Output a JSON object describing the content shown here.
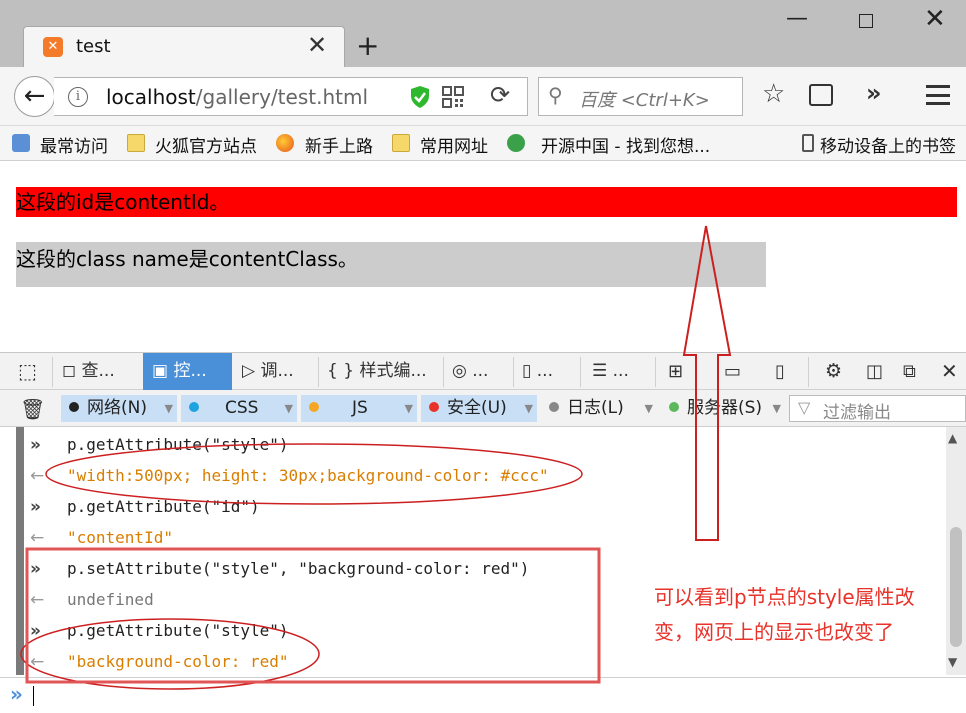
{
  "window": {
    "tab_title": "test",
    "tab_icon_glyph": "✕",
    "new_tab": "+",
    "minimize": "—",
    "close": "✕"
  },
  "nav": {
    "back": "←",
    "url_host": "localhost",
    "url_path": "/gallery/test.html",
    "reload": "⟳",
    "search_placeholder": "百度 <Ctrl+K>",
    "more": "»"
  },
  "bookmarks": [
    {
      "label": "最常访问",
      "icon": "most-visited-icon"
    },
    {
      "label": "火狐官方站点",
      "icon": "folder-icon"
    },
    {
      "label": "新手上路",
      "icon": "firefox-icon"
    },
    {
      "label": "常用网址",
      "icon": "folder-icon"
    },
    {
      "label": "开源中国 - 找到您想...",
      "icon": "oschina-icon"
    },
    {
      "label": "移动设备上的书签",
      "icon": "mobile-icon"
    }
  ],
  "page": {
    "para_id": "这段的id是contentId。",
    "para_class": "这段的class name是contentClass。"
  },
  "devtools": {
    "tabs": [
      {
        "label": "查...",
        "icon": "inspector-icon"
      },
      {
        "label": "控...",
        "icon": "console-icon",
        "active": true
      },
      {
        "label": "调...",
        "icon": "debugger-icon"
      },
      {
        "label": "样式编...",
        "icon": "style-editor-icon"
      },
      {
        "label": "...",
        "icon": "performance-icon"
      },
      {
        "label": "...",
        "icon": "memory-icon"
      },
      {
        "label": "...",
        "icon": "network-icon"
      }
    ],
    "filters": [
      {
        "label": "网络(N)",
        "color": "#222222",
        "on": true
      },
      {
        "label": "CSS",
        "color": "#1fa3e0",
        "on": true
      },
      {
        "label": "JS",
        "color": "#f5a623",
        "on": true
      },
      {
        "label": "安全(U)",
        "color": "#e8322a",
        "on": true
      },
      {
        "label": "日志(L)",
        "color": "#888888",
        "on": false
      },
      {
        "label": "服务器(S)",
        "color": "#5cb85c",
        "on": false
      }
    ],
    "filter_placeholder": "过滤输出"
  },
  "console": {
    "lines": [
      {
        "kind": "in",
        "text": "p.getAttribute(\"style\")"
      },
      {
        "kind": "out",
        "text": "\"width:500px; height: 30px;background-color: #ccc\""
      },
      {
        "kind": "in",
        "text": "p.getAttribute(\"id\")"
      },
      {
        "kind": "out",
        "text": "\"contentId\""
      },
      {
        "kind": "in",
        "text": "p.setAttribute(\"style\", \"background-color: red\")"
      },
      {
        "kind": "undef",
        "text": "undefined"
      },
      {
        "kind": "in",
        "text": "p.getAttribute(\"style\")"
      },
      {
        "kind": "out",
        "text": "\"background-color: red\""
      }
    ],
    "in_marker": "»",
    "out_marker": "←",
    "prompt": "»"
  },
  "annotation": {
    "text": "可以看到p节点的style属性改变，网页上的显示也改变了",
    "color": "#e8322a"
  }
}
